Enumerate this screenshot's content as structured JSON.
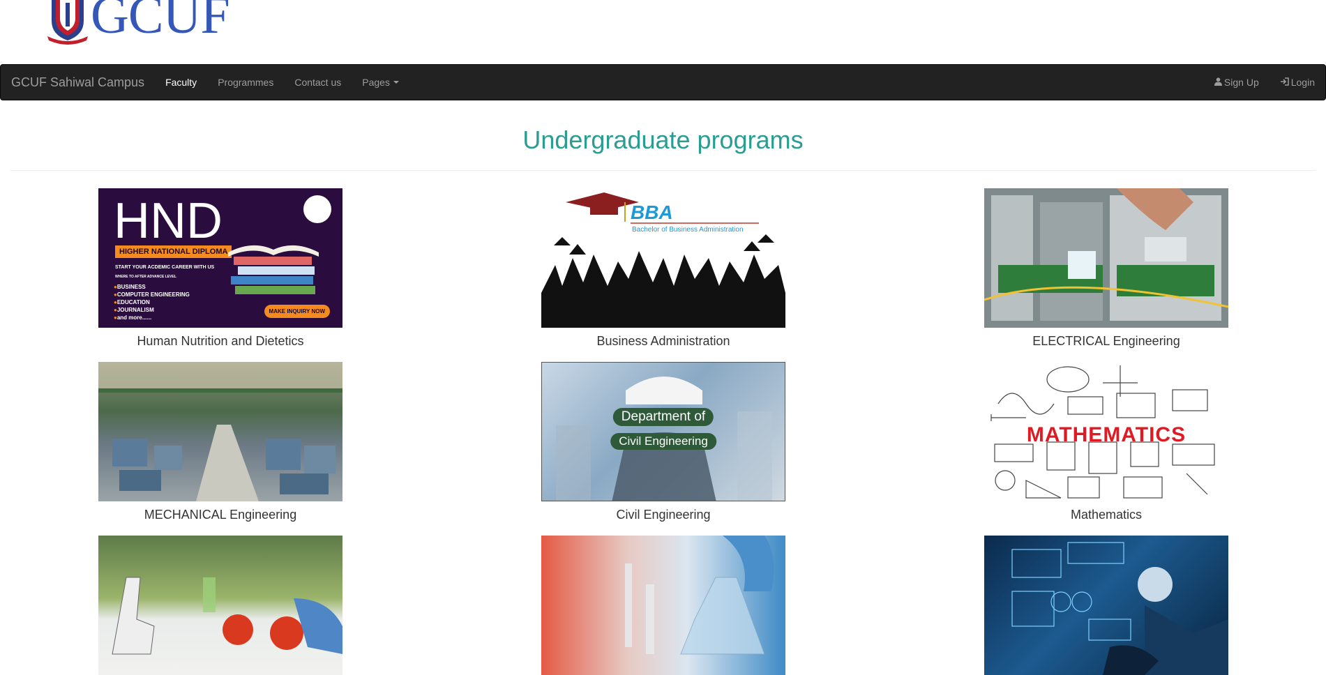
{
  "logo": {
    "text": "GCUF",
    "crest": "university-crest"
  },
  "navbar": {
    "brand": "GCUF Sahiwal Campus",
    "items": [
      {
        "label": "Faculty",
        "active": true
      },
      {
        "label": "Programmes",
        "active": false
      },
      {
        "label": "Contact us",
        "active": false
      },
      {
        "label": "Pages",
        "active": false,
        "dropdown": true
      }
    ],
    "right": [
      {
        "label": "Sign Up",
        "icon": "user-icon"
      },
      {
        "label": "Login",
        "icon": "login-icon"
      }
    ]
  },
  "page": {
    "heading": "Undergraduate programs"
  },
  "programs": [
    {
      "caption": "Human Nutrition and Dietetics",
      "image": "hnd-banner",
      "banner": {
        "big": "HND",
        "tag": "HIGHER NATIONAL DIPLOMA",
        "line1": "START YOUR ACDEMIC CAREER WITH US",
        "line2": "WHERE TO AFTER ADVANCE LEVEL",
        "list": [
          "BUSINESS",
          "COMPUTER ENGINEERING",
          "EDUCATION",
          "JOURNALISM",
          "and more......"
        ],
        "button": "MAKE INQUIRY NOW"
      }
    },
    {
      "caption": "Business Administration",
      "image": "bba-graduates",
      "banner": {
        "big": "BBA",
        "sub": "Bachelor of Business Administration"
      }
    },
    {
      "caption": "ELECTRICAL Engineering",
      "image": "electrical-panel"
    },
    {
      "caption": "MECHANICAL Engineering",
      "image": "mechanical-workshop"
    },
    {
      "caption": "Civil Engineering",
      "image": "civil-engineer",
      "banner": {
        "line1": "Department of",
        "line2": "Civil Engineering"
      }
    },
    {
      "caption": "Mathematics",
      "image": "mathematics-doodles",
      "banner": {
        "word": "MATHEMATICS"
      }
    },
    {
      "caption": "",
      "image": "biology-lab"
    },
    {
      "caption": "",
      "image": "chemistry-lab"
    },
    {
      "caption": "",
      "image": "ai-technology"
    }
  ],
  "colors": {
    "heading": "#2a9d93",
    "navbar": "#222222",
    "logo": "#3558b8"
  }
}
